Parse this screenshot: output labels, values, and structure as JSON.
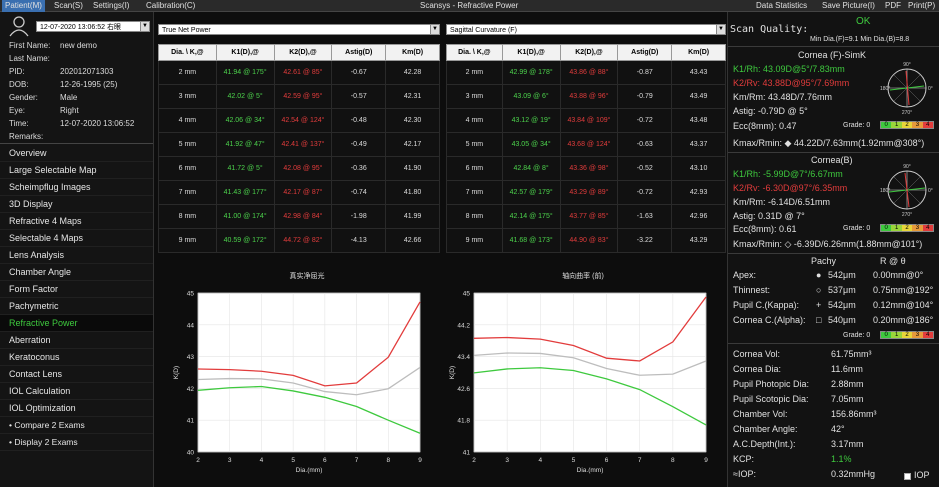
{
  "menubar": {
    "items": [
      "Patient(M)",
      "Scan(S)",
      "Settings(I)",
      "Calibration(C)"
    ],
    "app_title": "Scansys - Refractive Power",
    "right_items": [
      "Data Statistics",
      "Save Picture(I)",
      "PDF",
      "Print(P)"
    ]
  },
  "profile": {
    "exam_select": "12-07-2020 13:06:52 右眼",
    "first_name_label": "First Name:",
    "first_name": "new demo",
    "last_name_label": "Last Name:",
    "last_name": "",
    "pid_label": "PID:",
    "pid": "202012071303",
    "dob_label": "DOB:",
    "dob": "12-26-1995  (25)",
    "gender_label": "Gender:",
    "gender": "Male",
    "eye_label": "Eye:",
    "eye": "Right",
    "time_label": "Time:",
    "time": "12-07-2020 13:06:52",
    "remarks_label": "Remarks:"
  },
  "nav": [
    {
      "label": "Overview"
    },
    {
      "label": "Large Selectable Map"
    },
    {
      "label": "Scheimpflug Images"
    },
    {
      "label": "3D Display"
    },
    {
      "label": "Refractive 4 Maps"
    },
    {
      "label": "Selectable 4 Maps"
    },
    {
      "label": "Lens Analysis"
    },
    {
      "label": "Chamber Angle"
    },
    {
      "label": "Form Factor"
    },
    {
      "label": "Pachymetric"
    },
    {
      "label": "Refractive Power"
    },
    {
      "label": "Aberration"
    },
    {
      "label": "Keratoconus"
    },
    {
      "label": "Contact Lens"
    },
    {
      "label": "IOL Calculation"
    },
    {
      "label": "IOL Optimization"
    },
    {
      "label": "Compare 2 Exams"
    },
    {
      "label": "Display 2 Exams"
    }
  ],
  "left_table": {
    "select": "True Net Power",
    "headers": [
      "Dia. \\ K,@",
      "K1(D),@",
      "K2(D),@",
      "Astig(D)",
      "Km(D)"
    ],
    "rows": [
      [
        "2 mm",
        "41.94 @ 175°",
        "42.61 @ 85°",
        "-0.67",
        "42.28"
      ],
      [
        "3 mm",
        "42.02 @ 5°",
        "42.59 @ 95°",
        "-0.57",
        "42.31"
      ],
      [
        "4 mm",
        "42.06 @ 34°",
        "42.54 @ 124°",
        "-0.48",
        "42.30"
      ],
      [
        "5 mm",
        "41.92 @ 47°",
        "42.41 @ 137°",
        "-0.49",
        "42.17"
      ],
      [
        "6 mm",
        "41.72 @ 5°",
        "42.08 @ 95°",
        "-0.36",
        "41.90"
      ],
      [
        "7 mm",
        "41.43 @ 177°",
        "42.17 @ 87°",
        "-0.74",
        "41.80"
      ],
      [
        "8 mm",
        "41.00 @ 174°",
        "42.98 @ 84°",
        "-1.98",
        "41.99"
      ],
      [
        "9 mm",
        "40.59 @ 172°",
        "44.72 @ 82°",
        "-4.13",
        "42.66"
      ]
    ]
  },
  "right_table": {
    "select": "Sagittal Curvature (F)",
    "headers": [
      "Dia. \\ K,@",
      "K1(D),@",
      "K2(D),@",
      "Astig(D)",
      "Km(D)"
    ],
    "rows": [
      [
        "2 mm",
        "42.99 @ 178°",
        "43.86 @ 88°",
        "-0.87",
        "43.43"
      ],
      [
        "3 mm",
        "43.09 @ 6°",
        "43.88 @ 96°",
        "-0.79",
        "43.49"
      ],
      [
        "4 mm",
        "43.12 @ 19°",
        "43.84 @ 109°",
        "-0.72",
        "43.48"
      ],
      [
        "5 mm",
        "43.05 @ 34°",
        "43.68 @ 124°",
        "-0.63",
        "43.37"
      ],
      [
        "6 mm",
        "42.84 @ 8°",
        "43.36 @ 98°",
        "-0.52",
        "43.10"
      ],
      [
        "7 mm",
        "42.57 @ 179°",
        "43.29 @ 89°",
        "-0.72",
        "42.93"
      ],
      [
        "8 mm",
        "42.14 @ 175°",
        "43.77 @ 85°",
        "-1.63",
        "42.96"
      ],
      [
        "9 mm",
        "41.68 @ 173°",
        "44.90 @ 83°",
        "-3.22",
        "43.29"
      ]
    ]
  },
  "chart_data": [
    {
      "type": "line",
      "title": "真实净屈光",
      "xlabel": "Dia.(mm)",
      "ylabel": "K(D)",
      "x": [
        2,
        3,
        4,
        5,
        6,
        7,
        8,
        9
      ],
      "xlim": [
        2,
        9
      ],
      "ylim": [
        40,
        45
      ],
      "xticks": [
        "2",
        "3",
        "4",
        "5",
        "6",
        "7",
        "8",
        "9"
      ],
      "yticks": [
        "40",
        "41",
        "42",
        "43",
        "44",
        "45"
      ],
      "grid": true,
      "series": [
        {
          "color": "#e23c3c",
          "values": [
            42.61,
            42.59,
            42.54,
            42.41,
            42.08,
            42.17,
            42.98,
            44.72
          ]
        },
        {
          "color": "#f0f0f0",
          "values": [
            42.28,
            42.31,
            42.3,
            42.17,
            41.9,
            41.8,
            41.99,
            42.66
          ]
        },
        {
          "color": "#3ec93e",
          "values": [
            41.94,
            42.02,
            42.06,
            41.92,
            41.72,
            41.43,
            41.0,
            40.59
          ]
        }
      ]
    },
    {
      "type": "line",
      "title": "轴向曲率 (前)",
      "xlabel": "Dia.(mm)",
      "ylabel": "K(D)",
      "x": [
        2,
        3,
        4,
        5,
        6,
        7,
        8,
        9
      ],
      "xlim": [
        2,
        9
      ],
      "ylim": [
        41,
        45
      ],
      "xticks": [
        "2",
        "3",
        "4",
        "5",
        "6",
        "7",
        "8",
        "9"
      ],
      "yticks": [
        "41",
        "41.8",
        "42.6",
        "43.4",
        "44.2",
        "45"
      ],
      "grid": true,
      "series": [
        {
          "color": "#e23c3c",
          "values": [
            43.86,
            43.88,
            43.84,
            43.68,
            43.36,
            43.29,
            43.77,
            44.9
          ]
        },
        {
          "color": "#f0f0f0",
          "values": [
            43.43,
            43.49,
            43.48,
            43.37,
            43.1,
            42.93,
            42.96,
            43.29
          ]
        },
        {
          "color": "#3ec93e",
          "values": [
            42.99,
            43.09,
            43.12,
            43.05,
            42.84,
            42.57,
            42.14,
            41.68
          ]
        }
      ]
    }
  ],
  "scan_quality": {
    "label": "Scan Quality:",
    "value": "OK",
    "min_dia": "Min Dia.(F)=9.1  Min Dia.(B)=8.8"
  },
  "cornea_f": {
    "title": "Cornea (F)-SimK",
    "k1": "K1/Rh:   43.09D@5°/7.83mm",
    "k2": "K2/Rv:   43.88D@95°/7.69mm",
    "km": "Km/Rm:   43.48D/7.76mm",
    "astig": "Astig:    -0.79D @ 5°",
    "ecc": "Ecc(8mm):  0.47",
    "grade": "Grade: 0",
    "kmax": "Kmax/Rmin: ◆ 44.22D/7.63mm(1.92mm@308°)"
  },
  "cornea_b": {
    "title": "Cornea(B)",
    "k1": "K1/Rh:   -5.99D@7°/6.67mm",
    "k2": "K2/Rv:   -6.30D@97°/6.35mm",
    "km": "Km/Rm:   -6.14D/6.51mm",
    "astig": "Astig:    0.31D @ 7°",
    "ecc": "Ecc(8mm):  0.61",
    "grade": "Grade: 0",
    "kmax": "Kmax/Rmin: ◇ -6.39D/6.26mm(1.88mm@101°)"
  },
  "compass": {
    "n90": "90°",
    "n180": "180°",
    "n0": "0°",
    "n270": "270°",
    "n135": "135°",
    "n45": "45°",
    "n225": "225°",
    "n315": "315°"
  },
  "grade_scale": [
    "0",
    "1",
    "2",
    "3",
    "4"
  ],
  "pachy": {
    "header_pachy": "Pachy",
    "header_r": "R @ θ",
    "rows": [
      {
        "label": "Apex:",
        "sym": "●",
        "pachy": "542μm",
        "r": "0.00mm@0°"
      },
      {
        "label": "Thinnest:",
        "sym": "○",
        "pachy": "537μm",
        "r": "0.75mm@192°"
      },
      {
        "label": "Pupil C.(Kappa):",
        "sym": "+",
        "pachy": "542μm",
        "r": "0.12mm@104°"
      },
      {
        "label": "Cornea C.(Alpha):",
        "sym": "□",
        "pachy": "540μm",
        "r": "0.20mm@186°"
      }
    ],
    "grade": "Grade: 0"
  },
  "measures": [
    {
      "label": "Cornea Vol:",
      "value": "61.75mm³"
    },
    {
      "label": "Cornea Dia:",
      "value": "11.6mm"
    },
    {
      "label": "Pupil Photopic Dia:",
      "value": "2.88mm"
    },
    {
      "label": "Pupil Scotopic Dia:",
      "value": "7.05mm"
    },
    {
      "label": "Chamber Vol:",
      "value": "156.86mm³"
    },
    {
      "label": "Chamber Angle:",
      "value": "42°"
    },
    {
      "label": "A.C.Depth(Int.):",
      "value": "3.17mm"
    },
    {
      "label": "KCP:",
      "value": "1.1%"
    },
    {
      "label": "≈IOP:",
      "value": "0.32mmHg"
    }
  ],
  "iop_checkbox": "IOP",
  "colors": {
    "accent": "#3a6fb0",
    "green": "#3ec93e",
    "red": "#e23c3c"
  }
}
